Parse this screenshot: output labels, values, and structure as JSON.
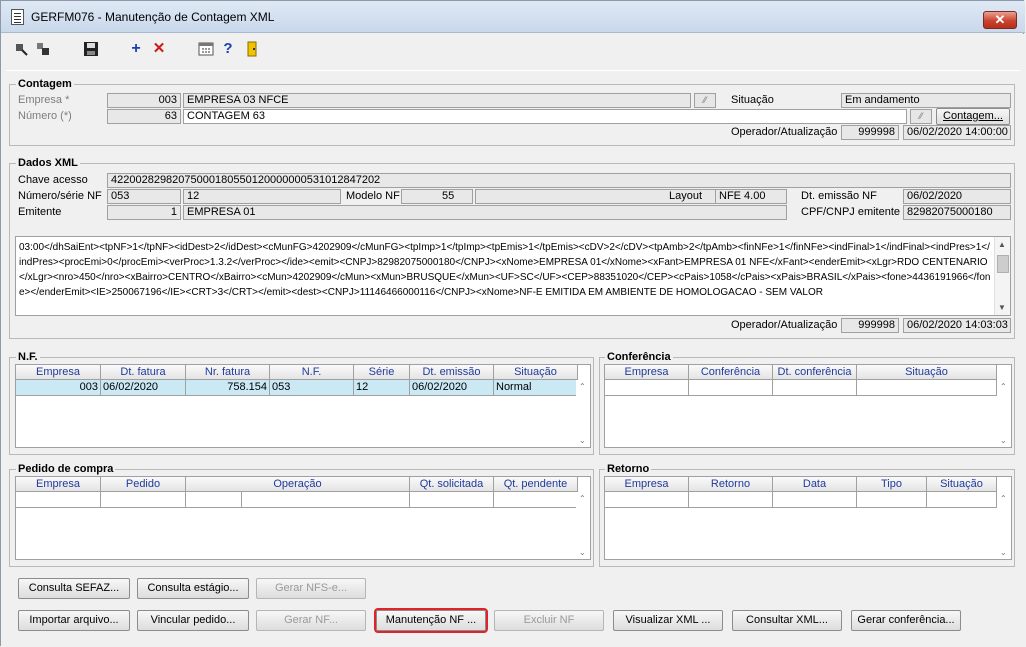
{
  "window": {
    "title": "GERFM076 - Manutenção de Contagem XML",
    "close_label": "✕"
  },
  "toolbar": {
    "icons": [
      "first-record-icon",
      "last-record-icon",
      "save-icon",
      "add-icon",
      "delete-icon",
      "calendar-icon",
      "help-icon",
      "exit-icon"
    ]
  },
  "contagem": {
    "title": "Contagem",
    "empresa_label": "Empresa *",
    "empresa_code": "003",
    "empresa_name": "EMPRESA 03 NFCE",
    "situacao_label": "Situação",
    "situacao_value": "Em andamento",
    "numero_label": "Número (*)",
    "numero_code": "63",
    "numero_desc": "CONTAGEM 63",
    "contagem_button": "Contagem...",
    "operador_label": "Operador/Atualização",
    "operador_value": "999998",
    "operador_date": "06/02/2020 14:00:00"
  },
  "dados_xml": {
    "title": "Dados XML",
    "chave_label": "Chave acesso",
    "chave_value": "42200282982075000180550120000000531012847202",
    "numero_serie_label": "Número/série NF",
    "numero_value": "053",
    "serie_value": "12",
    "modelo_label": "Modelo NF",
    "modelo_value": "55",
    "layout_label": "Layout",
    "layout_value": "NFE 4.00",
    "dt_emissao_label": "Dt. emissão NF",
    "dt_emissao_value": "06/02/2020",
    "emitente_label": "Emitente",
    "emitente_code": "1",
    "emitente_name": "EMPRESA 01",
    "cpf_label": "CPF/CNPJ emitente",
    "cpf_value": "82982075000180",
    "xml_content": "03:00</dhSaiEnt><tpNF>1</tpNF><idDest>2</idDest><cMunFG>4202909</cMunFG><tpImp>1</tpImp><tpEmis>1</tpEmis><cDV>2</cDV><tpAmb>2</tpAmb><finNFe>1</finNFe><indFinal>1</indFinal><indPres>1</indPres><procEmi>0</procEmi><verProc>1.3.2</verProc></ide><emit><CNPJ>82982075000180</CNPJ><xNome>EMPRESA 01</xNome><xFant>EMPRESA 01 NFE</xFant><enderEmit><xLgr>RDO CENTENARIO</xLgr><nro>450</nro><xBairro>CENTRO</xBairro><cMun>4202909</cMun><xMun>BRUSQUE</xMun><UF>SC</UF><CEP>88351020</CEP><cPais>1058</cPais><xPais>BRASIL</xPais><fone>4436191966</fone></enderEmit><IE>250067196</IE><CRT>3</CRT></emit><dest><CNPJ>11146466000116</CNPJ><xNome>NF-E EMITIDA EM AMBIENTE DE HOMOLOGACAO - SEM VALOR",
    "operador_label": "Operador/Atualização",
    "operador_value": "999998",
    "operador_date": "06/02/2020 14:03:03"
  },
  "nf": {
    "title": "N.F.",
    "columns": [
      "Empresa",
      "Dt. fatura",
      "Nr. fatura",
      "N.F.",
      "Série",
      "Dt. emissão",
      "Situação"
    ],
    "rows": [
      [
        "003",
        "06/02/2020",
        "758.154",
        "053",
        "12",
        "06/02/2020",
        "Normal"
      ]
    ]
  },
  "conferencia": {
    "title": "Conferência",
    "columns": [
      "Empresa",
      "Conferência",
      "Dt. conferência",
      "Situação"
    ]
  },
  "pedido": {
    "title": "Pedido de compra",
    "columns": [
      "Empresa",
      "Pedido",
      "Operação",
      "Qt. solicitada",
      "Qt. pendente"
    ]
  },
  "retorno": {
    "title": "Retorno",
    "columns": [
      "Empresa",
      "Retorno",
      "Data",
      "Tipo",
      "Situação"
    ]
  },
  "buttons": {
    "consulta_sefaz": "Consulta SEFAZ...",
    "consulta_estagio": "Consulta estágio...",
    "gerar_nfse": "Gerar NFS-e...",
    "importar_arquivo": "Importar arquivo...",
    "vincular_pedido": "Vincular pedido...",
    "gerar_nf": "Gerar NF...",
    "manutencao_nf": "Manutenção NF ...",
    "excluir_nf": "Excluir NF",
    "visualizar_xml": "Visualizar XML ...",
    "consultar_xml": "Consultar XML...",
    "gerar_conferencia": "Gerar conferência..."
  },
  "colors": {
    "selected_row": "#cbe8f5",
    "header_text": "#1f3a9c",
    "focus_outline": "#e0232a"
  }
}
